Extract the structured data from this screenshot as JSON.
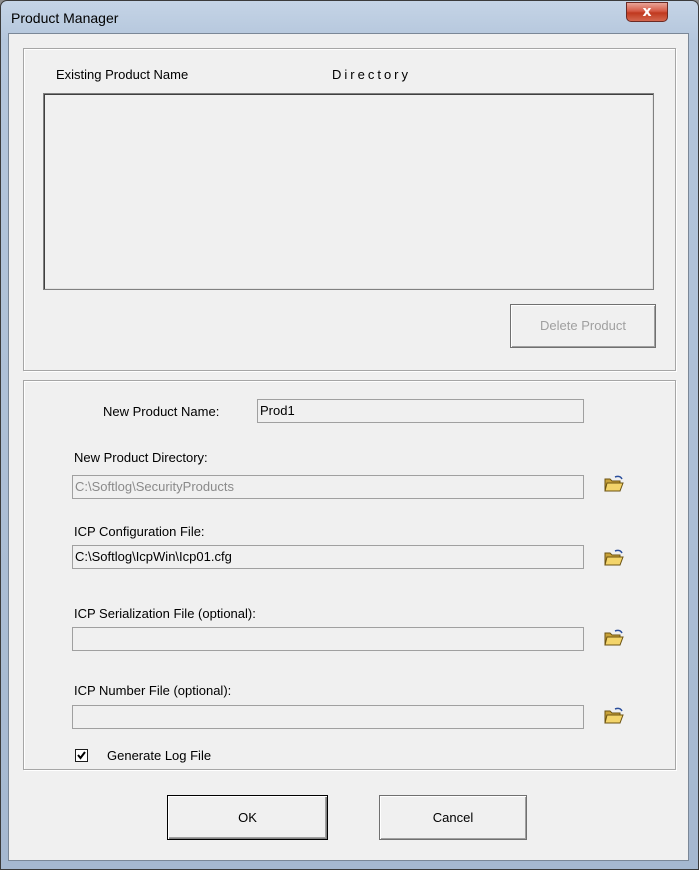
{
  "window": {
    "title": "Product Manager",
    "close_label": "x"
  },
  "list": {
    "col_name": "Existing Product Name",
    "col_dir": "Directory"
  },
  "buttons": {
    "delete": "Delete Product",
    "ok": "OK",
    "cancel": "Cancel"
  },
  "form": {
    "product_name_label": "New Product Name:",
    "product_name_value": "Prod1",
    "directory_label": "New Product Directory:",
    "directory_value": "C:\\Softlog\\SecurityProducts",
    "config_label": "ICP Configuration File:",
    "config_value": "C:\\Softlog\\IcpWin\\Icp01.cfg",
    "serialization_label": "ICP Serialization File (optional):",
    "serialization_value": "",
    "number_label": "ICP Number File (optional):",
    "number_value": "",
    "log_label": "Generate Log File",
    "log_checked": true
  },
  "icons": {
    "browse": "folder-open-icon",
    "check": "checkmark-icon"
  }
}
